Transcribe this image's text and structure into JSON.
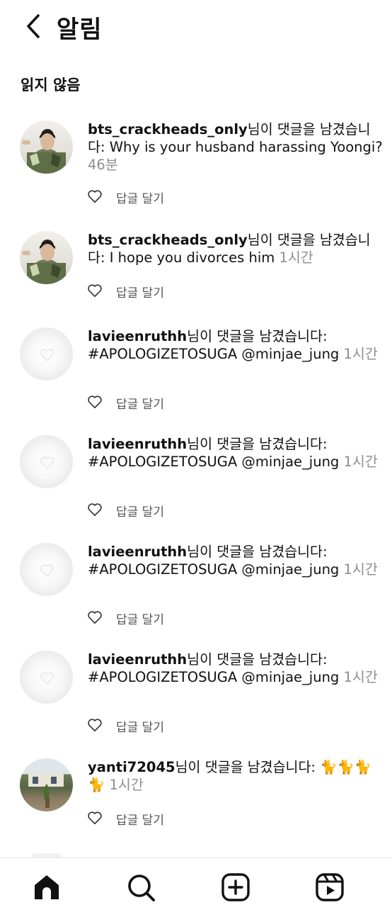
{
  "header": {
    "title": "알림",
    "back_icon": "back-arrow-icon"
  },
  "section": {
    "title": "읽지 않음"
  },
  "notifications": [
    {
      "username": "bts_crackheads_only",
      "text_line1": "님이 댓글을 남겼습니",
      "text_rest": "다: Why is your husband harassing Yoongi? ",
      "time": "46분",
      "avatar": "person-photo",
      "like_icon": "heart-icon",
      "reply_label": "답글 달기"
    },
    {
      "username": "bts_crackheads_only",
      "text_line1": "님이 댓글을 남겼습니",
      "text_rest": "다: I hope you divorces him ",
      "time": "1시간",
      "avatar": "person-photo",
      "like_icon": "heart-icon",
      "reply_label": "답글 달기"
    },
    {
      "username": "lavieenruthh",
      "text_line1": "님이 댓글을 남겼습니다:",
      "text_rest": "#APOLOGIZETOSUGA @minjae_jung ",
      "time": "1시간",
      "avatar": "blank-heart",
      "like_icon": "heart-icon",
      "reply_label": "답글 달기"
    },
    {
      "username": "lavieenruthh",
      "text_line1": "님이 댓글을 남겼습니다:",
      "text_rest": "#APOLOGIZETOSUGA @minjae_jung ",
      "time": "1시간",
      "avatar": "blank-heart",
      "like_icon": "heart-icon",
      "reply_label": "답글 달기"
    },
    {
      "username": "lavieenruthh",
      "text_line1": "님이 댓글을 남겼습니다:",
      "text_rest": "#APOLOGIZETOSUGA @minjae_jung ",
      "time": "1시간",
      "avatar": "blank-heart",
      "like_icon": "heart-icon",
      "reply_label": "답글 달기"
    },
    {
      "username": "lavieenruthh",
      "text_line1": "님이 댓글을 남겼습니다:",
      "text_rest": "#APOLOGIZETOSUGA @minjae_jung ",
      "time": "1시간",
      "avatar": "blank-heart",
      "like_icon": "heart-icon",
      "reply_label": "답글 달기"
    },
    {
      "username": "yanti72045",
      "text_line1": "님이 댓글을 남겼습니다: ",
      "text_rest": "🐈🐈🐈🐈 ",
      "time": "1시간",
      "avatar": "outdoor-scene",
      "like_icon": "heart-icon",
      "reply_label": "답글 달기"
    }
  ],
  "tabbar": {
    "items": [
      "home-icon",
      "search-icon",
      "create-post-icon",
      "reels-icon"
    ]
  },
  "colors": {
    "text": "#111111",
    "muted": "#8e8e8e",
    "divider": "#e8e8e8"
  }
}
